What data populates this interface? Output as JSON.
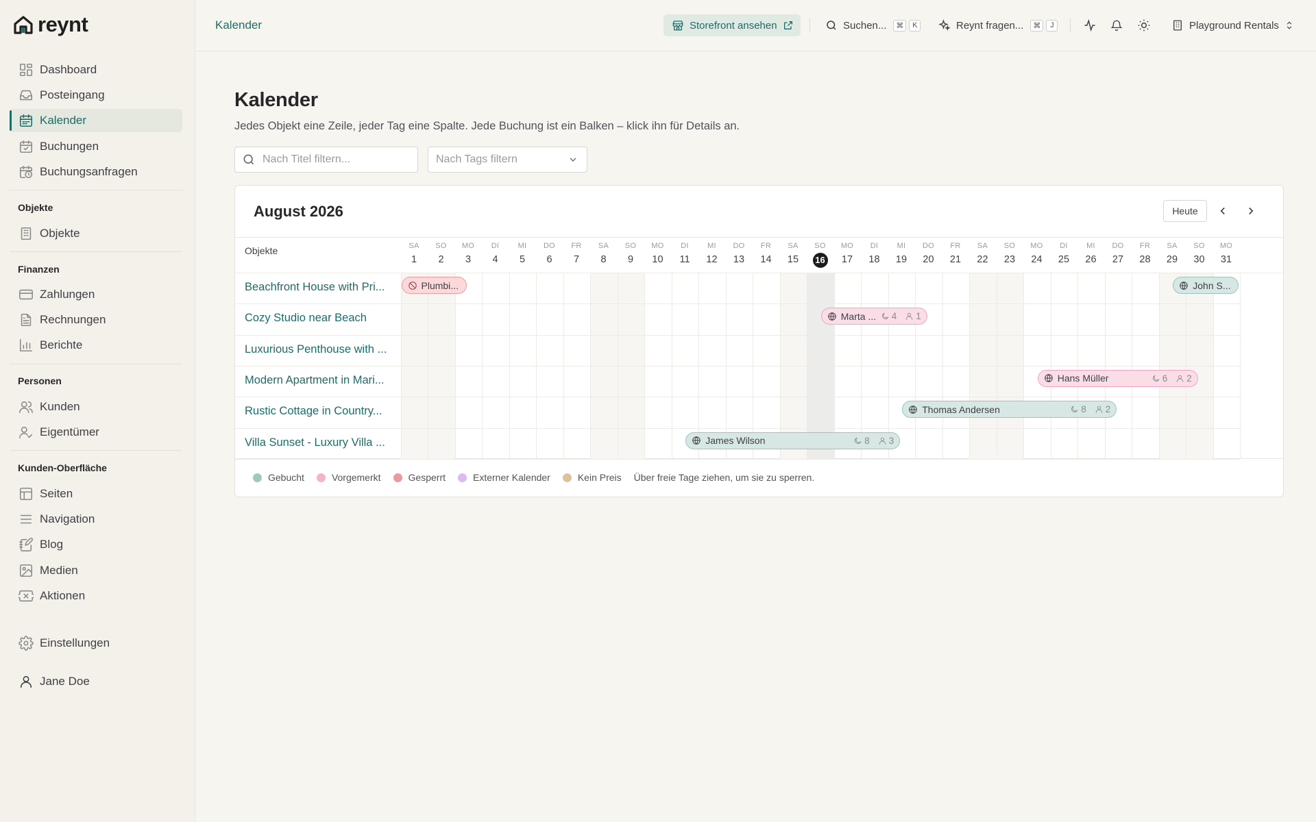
{
  "brand": {
    "name": "reynt"
  },
  "sidebar": {
    "items_top": [
      {
        "label": "Dashboard",
        "icon": "dashboard-icon"
      },
      {
        "label": "Posteingang",
        "icon": "inbox-icon"
      },
      {
        "label": "Kalender",
        "icon": "calendar-icon",
        "active": true
      },
      {
        "label": "Buchungen",
        "icon": "calendar-check-icon"
      },
      {
        "label": "Buchungsanfragen",
        "icon": "calendar-clock-icon"
      }
    ],
    "sections": [
      {
        "label": "Objekte",
        "items": [
          {
            "label": "Objekte",
            "icon": "building-icon"
          }
        ]
      },
      {
        "label": "Finanzen",
        "items": [
          {
            "label": "Zahlungen",
            "icon": "credit-card-icon"
          },
          {
            "label": "Rechnungen",
            "icon": "file-text-icon"
          },
          {
            "label": "Berichte",
            "icon": "bar-chart-icon"
          }
        ]
      },
      {
        "label": "Personen",
        "items": [
          {
            "label": "Kunden",
            "icon": "users-icon"
          },
          {
            "label": "Eigentümer",
            "icon": "user-check-icon"
          }
        ]
      },
      {
        "label": "Kunden-Oberfläche",
        "items": [
          {
            "label": "Seiten",
            "icon": "layout-icon"
          },
          {
            "label": "Navigation",
            "icon": "menu-icon"
          },
          {
            "label": "Blog",
            "icon": "notebook-pen-icon"
          },
          {
            "label": "Medien",
            "icon": "image-icon"
          },
          {
            "label": "Aktionen",
            "icon": "ticket-icon"
          }
        ]
      }
    ],
    "settings": "Einstellungen",
    "user": "Jane Doe"
  },
  "topbar": {
    "breadcrumb": "Kalender",
    "storefront": "Storefront ansehen",
    "search": "Suchen...",
    "search_keys": [
      "⌘",
      "K"
    ],
    "ask": "Reynt fragen...",
    "ask_keys": [
      "⌘",
      "J"
    ],
    "workspace": "Playground Rentals"
  },
  "page": {
    "title": "Kalender",
    "subtitle": "Jedes Objekt eine Zeile, jeder Tag eine Spalte. Jede Buchung ist ein Balken – klick ihn für Details an.",
    "filter_title_placeholder": "Nach Titel filtern...",
    "filter_tags_placeholder": "Nach Tags filtern"
  },
  "calendar": {
    "month": "August 2026",
    "today_label": "Heute",
    "objects_header": "Objekte",
    "today_day": 16,
    "dows": [
      "SA",
      "SO",
      "MO",
      "DI",
      "MI",
      "DO",
      "FR",
      "SA",
      "SO",
      "MO",
      "DI",
      "MI",
      "DO",
      "FR",
      "SA",
      "SO",
      "MO",
      "DI",
      "MI",
      "DO",
      "FR",
      "SA",
      "SO",
      "MO",
      "DI",
      "MI",
      "DO",
      "FR",
      "SA",
      "SO",
      "MO"
    ],
    "weekend_days": [
      1,
      2,
      8,
      9,
      15,
      16,
      22,
      23,
      29,
      30
    ],
    "properties": [
      "Beachfront House with Pri...",
      "Cozy Studio near Beach",
      "Luxurious Penthouse with ...",
      "Modern Apartment in Mari...",
      "Rustic Cottage in Country...",
      "Villa Sunset - Luxury Villa ..."
    ],
    "bookings": [
      {
        "row": 0,
        "start": 1,
        "end": 3.5,
        "status": "blocked",
        "icon": "ban-icon",
        "label": "Plumbi..."
      },
      {
        "row": 0,
        "start": 29.5,
        "end": 32,
        "status": "booked",
        "icon": "globe-icon",
        "label": "John S..."
      },
      {
        "row": 1,
        "start": 16.5,
        "end": 20.5,
        "status": "reserved",
        "icon": "globe-icon",
        "label": "Marta ...",
        "nights": "4",
        "guests": "1"
      },
      {
        "row": 3,
        "start": 24.5,
        "end": 30.5,
        "status": "reserved",
        "icon": "globe-icon",
        "label": "Hans Müller",
        "nights": "6",
        "guests": "2"
      },
      {
        "row": 4,
        "start": 19.5,
        "end": 27.5,
        "status": "booked",
        "icon": "globe-icon",
        "label": "Thomas Andersen",
        "nights": "8",
        "guests": "2"
      },
      {
        "row": 5,
        "start": 11.5,
        "end": 19.5,
        "status": "booked",
        "icon": "globe-icon",
        "label": "James Wilson",
        "nights": "8",
        "guests": "3"
      }
    ],
    "legend": [
      {
        "label": "Gebucht",
        "color": "#9fc9c0"
      },
      {
        "label": "Vorgemerkt",
        "color": "#f5b3cc"
      },
      {
        "label": "Gesperrt",
        "color": "#e89a9e"
      },
      {
        "label": "Externer Kalender",
        "color": "#dcb9f0"
      },
      {
        "label": "Kein Preis",
        "color": "#dcc39b"
      }
    ],
    "hint": "Über freie Tage ziehen, um sie zu sperren."
  },
  "colors": {
    "accent": "#1f6b68",
    "today": "#1c1c1c"
  }
}
